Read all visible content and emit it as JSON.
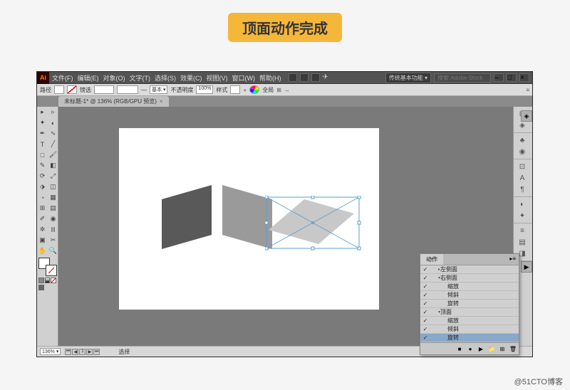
{
  "caption": "顶面动作完成",
  "menu": [
    "文件(F)",
    "编辑(E)",
    "对象(O)",
    "文字(T)",
    "选择(S)",
    "效果(C)",
    "视图(V)",
    "窗口(W)",
    "帮助(H)"
  ],
  "workspace": "传统基本功能",
  "search_placeholder": "搜索 Adobe Stock",
  "control": {
    "label": "路径",
    "stroke_unit": "镑选",
    "style_label": "基本",
    "opacity_label": "不透明度",
    "opacity_value": "100%",
    "style2_label": "样式",
    "align_label": "全局"
  },
  "doc_tab": "未标题-1* @ 136% (RGB/GPU 预览)",
  "zoom": "136%",
  "status_label": "选择",
  "actions_panel": {
    "title": "动作",
    "items": [
      {
        "check": "✓",
        "toggle": "▸",
        "indent": 1,
        "label": "左侧面"
      },
      {
        "check": "✓",
        "toggle": "▾",
        "indent": 1,
        "label": "右侧面"
      },
      {
        "check": "✓",
        "toggle": "",
        "indent": 2,
        "label": "缩放"
      },
      {
        "check": "✓",
        "toggle": "",
        "indent": 2,
        "label": "倾斜"
      },
      {
        "check": "✓",
        "toggle": "",
        "indent": 2,
        "label": "旋转"
      },
      {
        "check": "✓",
        "toggle": "▾",
        "indent": 1,
        "label": "顶面"
      },
      {
        "check": "✓",
        "toggle": "",
        "indent": 2,
        "label": "缩放"
      },
      {
        "check": "✓",
        "toggle": "",
        "indent": 2,
        "label": "倾斜"
      },
      {
        "check": "✓",
        "toggle": "",
        "indent": 2,
        "label": "旋转",
        "selected": true
      }
    ]
  },
  "footer": "@51CTO博客"
}
